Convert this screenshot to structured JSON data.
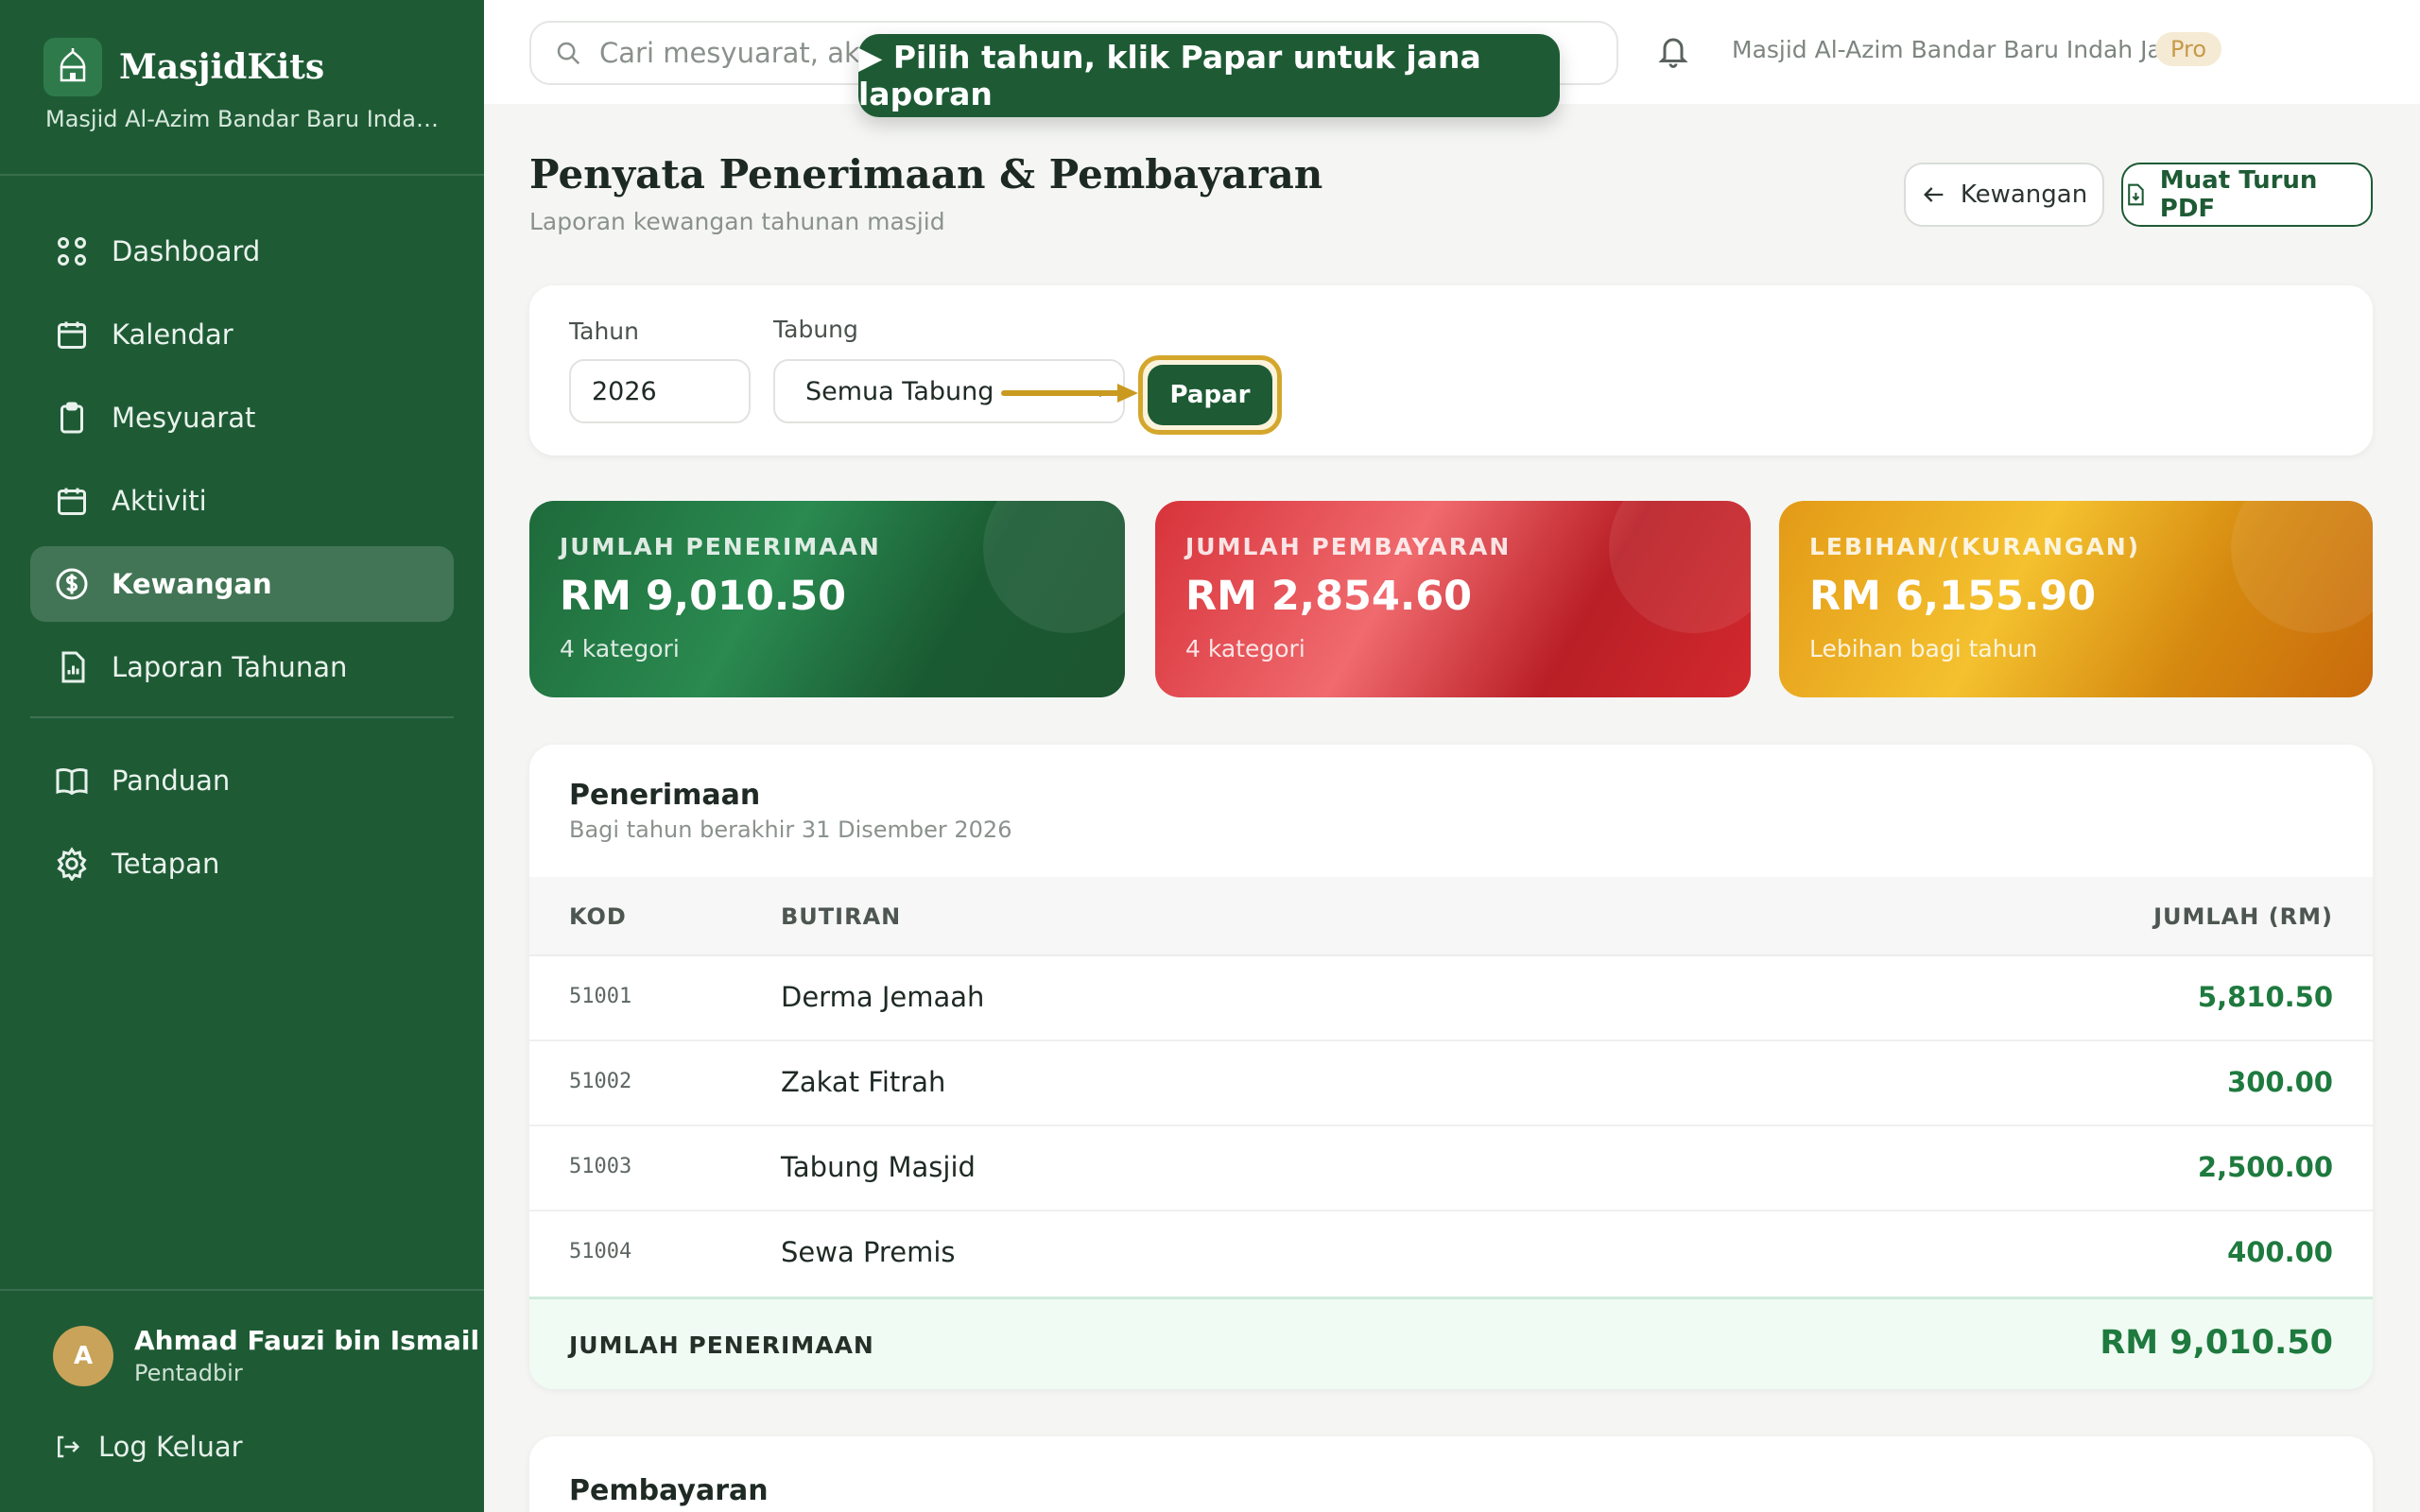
{
  "brand": {
    "name": "MasjidKits",
    "subtitle": "Masjid Al-Azim Bandar Baru Indah Jaya"
  },
  "sidebar": {
    "items": [
      {
        "label": "Dashboard",
        "icon": "grid-icon"
      },
      {
        "label": "Kalendar",
        "icon": "calendar-icon"
      },
      {
        "label": "Mesyuarat",
        "icon": "clipboard-icon"
      },
      {
        "label": "Aktiviti",
        "icon": "calendar-icon"
      },
      {
        "label": "Kewangan",
        "icon": "dollar-circle-icon",
        "active": true
      },
      {
        "label": "Laporan Tahunan",
        "icon": "report-icon"
      }
    ],
    "secondary": [
      {
        "label": "Panduan",
        "icon": "book-icon"
      },
      {
        "label": "Tetapan",
        "icon": "gear-icon"
      }
    ],
    "user": {
      "initial": "A",
      "name": "Ahmad Fauzi bin Ismail",
      "role": "Pentadbir"
    },
    "logout": "Log Keluar"
  },
  "header": {
    "search_placeholder": "Cari mesyuarat, aktiviti...",
    "org_name": "Masjid Al-Azim Bandar Baru Indah Jaya",
    "plan_badge": "Pro",
    "tooltip": "▶ Pilih tahun, klik Papar untuk jana laporan"
  },
  "page": {
    "title": "Penyata Penerimaan & Pembayaran",
    "subtitle": "Laporan kewangan tahunan masjid",
    "back_button": "Kewangan",
    "pdf_button": "Muat Turun PDF"
  },
  "filters": {
    "year_label": "Tahun",
    "year_value": "2026",
    "fund_label": "Tabung",
    "fund_value": "Semua Tabung",
    "submit": "Papar"
  },
  "stats": [
    {
      "label": "JUMLAH PENERIMAAN",
      "value": "RM 9,010.50",
      "sub": "4 kategori",
      "color": "#1e6a3a"
    },
    {
      "label": "JUMLAH PEMBAYARAN",
      "value": "RM 2,854.60",
      "sub": "4 kategori",
      "color": "#d7333a"
    },
    {
      "label": "LEBIHAN/(KURANGAN)",
      "value": "RM 6,155.90",
      "sub": "Lebihan bagi tahun",
      "color": "#e39a17"
    }
  ],
  "receipts": {
    "title": "Penerimaan",
    "subtitle": "Bagi tahun berakhir 31 Disember 2026",
    "columns": [
      "KOD",
      "BUTIRAN",
      "JUMLAH (RM)"
    ],
    "rows": [
      {
        "code": "51001",
        "desc": "Derma Jemaah",
        "amount": "5,810.50"
      },
      {
        "code": "51002",
        "desc": "Zakat Fitrah",
        "amount": "300.00"
      },
      {
        "code": "51003",
        "desc": "Tabung Masjid",
        "amount": "2,500.00"
      },
      {
        "code": "51004",
        "desc": "Sewa Premis",
        "amount": "400.00"
      }
    ],
    "total_label": "JUMLAH PENERIMAAN",
    "total_value": "RM 9,010.50"
  },
  "payments": {
    "title": "Pembayaran"
  }
}
